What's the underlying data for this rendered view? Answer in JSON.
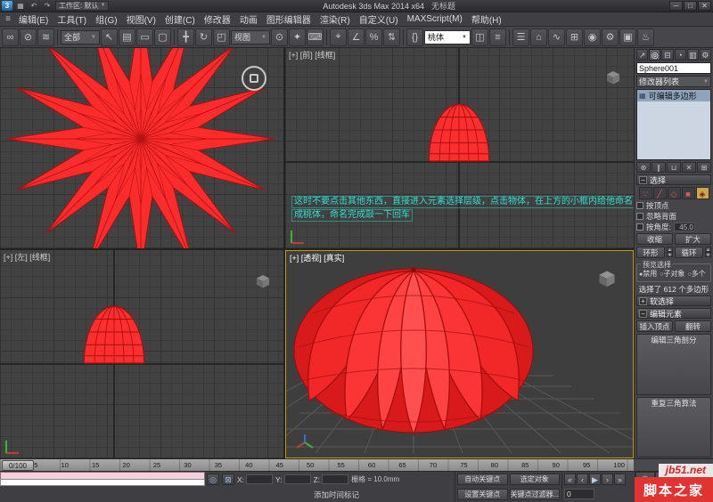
{
  "title_bar": {
    "app_button": "3",
    "workspace": "工作区: 默认",
    "app_title": "Autodesk 3ds Max 2014 x64",
    "doc_title": "无标题",
    "quick_access": {
      "save": "▦",
      "undo": "↶",
      "redo": "↷"
    },
    "window": {
      "minimize": "─",
      "maximize": "□",
      "close": "✕"
    }
  },
  "menu_bar": {
    "app_menu_icon": "≡",
    "items": [
      "编辑(E)",
      "工具(T)",
      "组(G)",
      "视图(V)",
      "创建(C)",
      "修改器",
      "动画",
      "图形编辑器",
      "渲染(R)",
      "自定义(U)",
      "MAXScript(M)",
      "帮助(H)"
    ]
  },
  "toolbar": {
    "selection_filter": "全部",
    "reference_coord": "视图",
    "named_selection_set": "桃体",
    "icons": {
      "link": "∞",
      "unlink": "⊘",
      "bind_warp": "≋",
      "select": "↖",
      "by_name": "▤",
      "region": "▭",
      "window": "▢",
      "move": "╋",
      "rotate": "↻",
      "scale": "◰",
      "pivot": "⊙",
      "manipulate": "✦",
      "keyboard": "⌨",
      "snap": "⌖",
      "angle_snap": "∠",
      "percent_snap": "%",
      "spinner_snap": "⇅",
      "named_sets": "{}",
      "mirror": "◫",
      "align": "≡",
      "layers": "☰",
      "graphite": "⌂",
      "curve_editor": "∿",
      "schematic": "⊞",
      "material": "◉",
      "render_setup": "⚙",
      "render_frame": "▣",
      "render": "♨"
    }
  },
  "viewports": {
    "front_label": "[+] [前] [线框]",
    "left_label": "[+] [左] [线框]",
    "persp_label": "[+] [透视] [真实]",
    "annotation_line1": "这时不要点击其他东西，直接进入元素选择层级，点击物体，在上方的小框内给他命名",
    "annotation_line2": "成桃体，命名完成敲一下回车"
  },
  "command_panel": {
    "tab_icons": {
      "create": "↗",
      "modify": "◎",
      "hierarchy": "⊟",
      "motion": "◔",
      "display": "▥",
      "utilities": "⚙"
    },
    "object_name": "Sphere001",
    "modifier_list_label": "修改器列表",
    "stack": [
      "可编辑多边形"
    ],
    "stack_icon": "▦",
    "stack_tools": {
      "pin": "⊛",
      "show_end": "∥",
      "unique": "⊔",
      "remove": "✕",
      "configure": "⊞"
    },
    "rollout_open": "−",
    "rollout_closed": "+",
    "subobj_icons": {
      "vertex": "∵",
      "edge": "╱",
      "border": "◇",
      "polygon": "■",
      "element": "◈"
    },
    "selection": {
      "title": "选择",
      "by_vertex": "按顶点",
      "ignore_backfacing": "忽略背面",
      "by_angle": "按角度:",
      "angle_value": "45.0",
      "shrink": "收缩",
      "grow": "扩大",
      "ring": "环形",
      "loop": "循环",
      "preview_title": "预览选择",
      "preview_disable": "禁用",
      "preview_subobj": "子对象",
      "preview_multi": "多个",
      "status": "选择了 612 个多边形"
    },
    "soft_selection_title": "软选择",
    "edit_elements": {
      "title": "编辑元素",
      "insert_vertex": "插入顶点",
      "flip": "翻转",
      "edit_triangulation": "编辑三角剖分",
      "retriangulate": "重复三角算法"
    }
  },
  "timeline": {
    "slider_label": "0/100",
    "ticks": [
      "0",
      "5",
      "10",
      "15",
      "20",
      "25",
      "30",
      "35",
      "40",
      "45",
      "50",
      "55",
      "60",
      "65",
      "70",
      "75",
      "80",
      "85",
      "90",
      "95",
      "100"
    ]
  },
  "status_bar": {
    "icons": {
      "isolate": "◎",
      "lock": "⊠"
    },
    "coord_x": "X:",
    "coord_y": "Y:",
    "coord_z": "Z:",
    "grid_size": "栅格 = 10.0mm",
    "add_time_tag": "添加时间标记",
    "auto_key": "自动关键点",
    "selected_set": "选定对象",
    "set_key": "设置关键点",
    "key_filters": "关键点过滤器...",
    "frame": "0",
    "playback": {
      "start": "«",
      "prev": "‹",
      "play": "▶",
      "next": "›",
      "end": "»"
    },
    "nav": {
      "zoom": "⊕",
      "zoom_all": "⊛",
      "extents": "⊡",
      "extents_all": "⊞",
      "region": "▧",
      "pan": "╋",
      "orbit": "↻",
      "maximize": "▣"
    }
  },
  "watermark": {
    "site": "jb51.net",
    "name": "脚本之家"
  },
  "colors": {
    "object_red": "#fd2c2c",
    "wire_dark_red": "#a80f0f",
    "annotation_teal": "#2fe0cf",
    "active_viewport_border": "#c79a00",
    "watermark_red": "#e23333"
  }
}
